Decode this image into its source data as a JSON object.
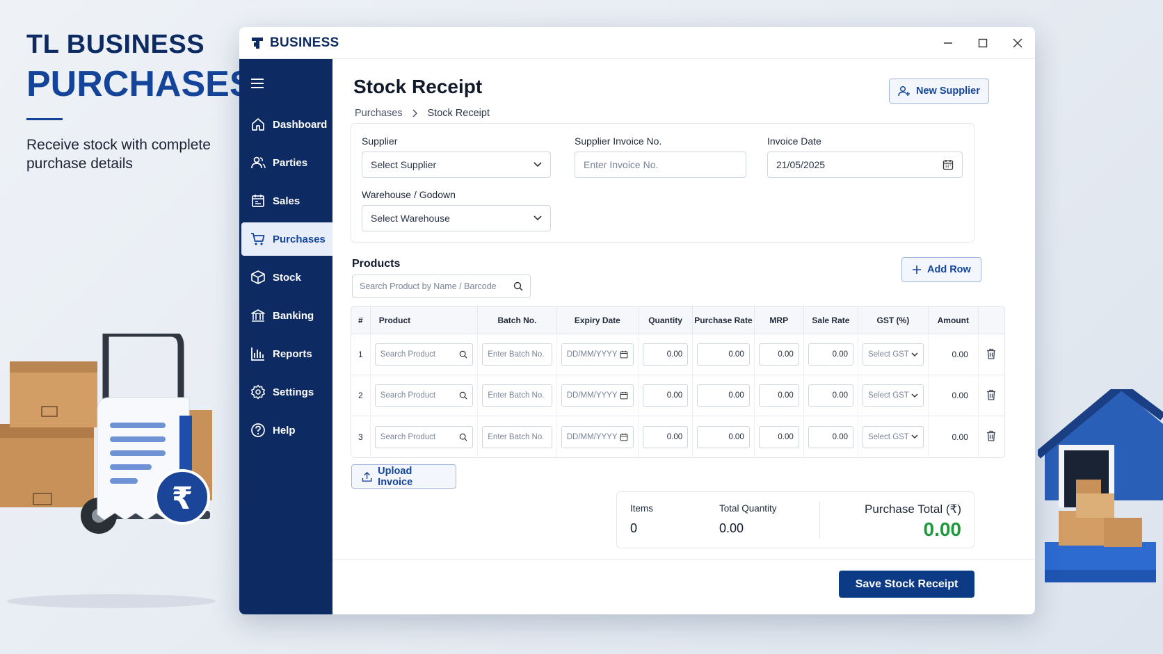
{
  "hero": {
    "line1": "TL BUSINESS",
    "line2": "PURCHASES",
    "subtitle": "Receive stock with complete purchase details"
  },
  "window": {
    "brand": "BUSINESS",
    "controls": [
      "minimize-icon",
      "maximize-icon",
      "close-icon"
    ]
  },
  "sidebar": {
    "items": [
      {
        "label": "Dashboard",
        "icon": "home-icon"
      },
      {
        "label": "Parties",
        "icon": "users-icon"
      },
      {
        "label": "Sales",
        "icon": "receipt-icon"
      },
      {
        "label": "Purchases",
        "icon": "cart-icon",
        "active": true
      },
      {
        "label": "Stock",
        "icon": "box-icon"
      },
      {
        "label": "Banking",
        "icon": "bank-icon"
      },
      {
        "label": "Reports",
        "icon": "chart-icon"
      },
      {
        "label": "Settings",
        "icon": "gear-icon"
      },
      {
        "label": "Help",
        "icon": "help-icon"
      }
    ]
  },
  "page": {
    "title": "Stock Receipt",
    "breadcrumb": [
      "Purchases",
      "Stock Receipt"
    ],
    "new_supplier": "New Supplier"
  },
  "form": {
    "supplier_label": "Supplier",
    "supplier_value": "Select Supplier",
    "invoice_no_label": "Supplier Invoice No.",
    "invoice_no_placeholder": "Enter Invoice No.",
    "invoice_date_label": "Invoice Date",
    "invoice_date_value": "21/05/2025",
    "warehouse_label": "Warehouse / Godown",
    "warehouse_value": "Select Warehouse"
  },
  "products": {
    "title": "Products",
    "search_placeholder": "Search Product by Name / Barcode",
    "add_row": "Add Row",
    "columns": [
      "#",
      "Product",
      "Batch No.",
      "Expiry Date",
      "Quantity",
      "Purchase Rate",
      "MRP",
      "Sale Rate",
      "GST (%)",
      "Amount",
      ""
    ],
    "rows": [
      {
        "n": "1",
        "product": "Search Product",
        "batch": "Enter Batch No.",
        "expiry": "DD/MM/YYYY",
        "qty": "0.00",
        "rate": "0.00",
        "mrp": "0.00",
        "sale": "0.00",
        "gst": "Select GST",
        "amount": "0.00"
      },
      {
        "n": "2",
        "product": "Search Product",
        "batch": "Enter Batch No.",
        "expiry": "DD/MM/YYYY",
        "qty": "0.00",
        "rate": "0.00",
        "mrp": "0.00",
        "sale": "0.00",
        "gst": "Select GST",
        "amount": "0.00"
      },
      {
        "n": "3",
        "product": "Search Product",
        "batch": "Enter Batch No.",
        "expiry": "DD/MM/YYYY",
        "qty": "0.00",
        "rate": "0.00",
        "mrp": "0.00",
        "sale": "0.00",
        "gst": "Select GST",
        "amount": "0.00"
      }
    ]
  },
  "upload_invoice": "Upload Invoice",
  "summary": {
    "items_label": "Items",
    "items_value": "0",
    "total_qty_label": "Total Quantity",
    "total_qty_value": "0.00",
    "purchase_total_label": "Purchase Total (₹)",
    "purchase_total_value": "0.00"
  },
  "save_button": "Save Stock Receipt",
  "colors": {
    "navy": "#0d2b62",
    "accent": "#14449a",
    "total_green": "#1e9a3c",
    "active_nav_bg": "#e8eef9"
  }
}
